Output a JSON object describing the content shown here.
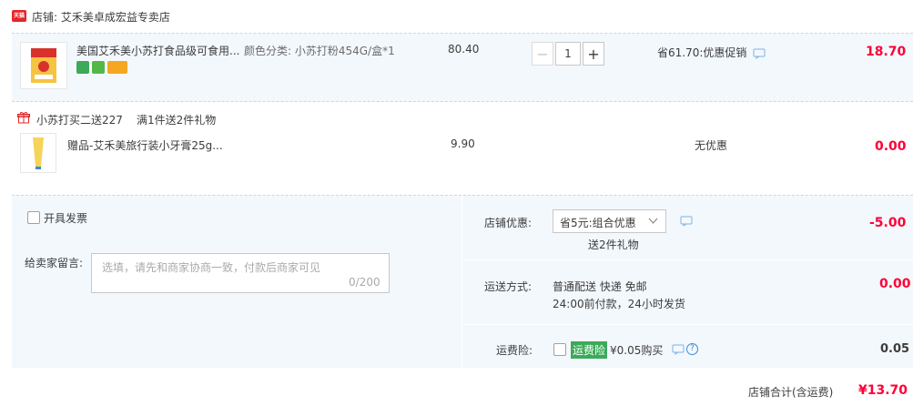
{
  "shop": {
    "name": "店铺: 艾禾美卓成宏益专卖店",
    "badge": "天猫"
  },
  "item": {
    "title": "美国艾禾美小苏打食品级可食用...",
    "sku": "颜色分类: 小苏打粉454G/盒*1",
    "unit_price": "80.40",
    "quantity": "1",
    "qty_minus": "−",
    "qty_plus": "+",
    "promo": "省61.70:优惠促销",
    "subtotal": "18.70"
  },
  "gift": {
    "promo_title": "小苏打买二送227",
    "promo_rule": "满1件送2件礼物",
    "title": "赠品-艾禾美旅行装小牙膏25g...",
    "price": "9.90",
    "discount": "无优惠",
    "subtotal": "0.00"
  },
  "invoice": {
    "label": "开具发票"
  },
  "message": {
    "label": "给卖家留言:",
    "placeholder": "选填，请先和商家协商一致，付款后商家可见",
    "counter": "0/200"
  },
  "shop_discount": {
    "label": "店铺优惠:",
    "selected": "省5元:组合优惠",
    "note": "送2件礼物",
    "amount": "-5.00"
  },
  "shipping": {
    "label": "运送方式:",
    "method": "普通配送 快递 免邮",
    "desc": "24:00前付款，24小时发货",
    "amount": "0.00"
  },
  "insurance": {
    "label": "运费险:",
    "tag": "运费险",
    "text": "¥0.05购买",
    "amount": "0.05"
  },
  "total": {
    "label": "店铺合计(含运费)",
    "amount": "¥13.70"
  },
  "colors": {
    "accent_red": "#ff0036",
    "link_blue": "#3b8ad9",
    "panel_bg": "#f3f8fd"
  },
  "icons": [
    "gift-icon",
    "chat-icon",
    "chevron-down-icon",
    "help-icon"
  ]
}
